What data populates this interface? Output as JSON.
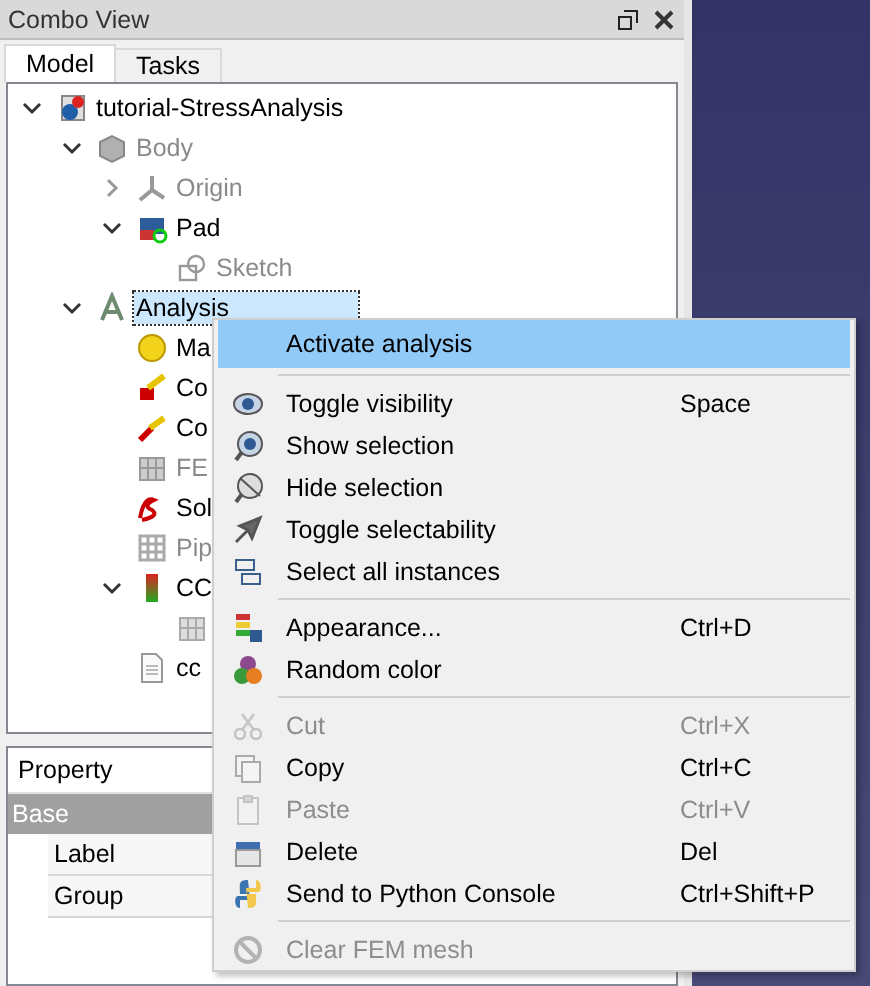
{
  "panel": {
    "title": "Combo View",
    "tabs": [
      {
        "label": "Model",
        "selected": true
      },
      {
        "label": "Tasks",
        "selected": false
      }
    ],
    "tree": [
      {
        "label": "tutorial-StressAnalysis",
        "expanded": true,
        "selected": false,
        "hidden": false,
        "children": [
          {
            "label": "Body",
            "expanded": true,
            "selected": false,
            "hidden": true,
            "children": [
              {
                "label": "Origin",
                "expanded": false,
                "selected": false,
                "hidden": true
              },
              {
                "label": "Pad",
                "expanded": true,
                "selected": false,
                "hidden": false,
                "children": [
                  {
                    "label": "Sketch",
                    "selected": false,
                    "hidden": true
                  }
                ]
              }
            ]
          },
          {
            "label": "Analysis",
            "expanded": true,
            "selected": true,
            "hidden": false,
            "children": [
              {
                "label": "Ma",
                "selected": false,
                "hidden": false
              },
              {
                "label": "Co",
                "selected": false,
                "hidden": false
              },
              {
                "label": "Co",
                "selected": false,
                "hidden": false
              },
              {
                "label": "FE",
                "selected": false,
                "hidden": true
              },
              {
                "label": "Sol",
                "selected": false,
                "hidden": false
              },
              {
                "label": "Pip",
                "selected": false,
                "hidden": true
              },
              {
                "label": "CC",
                "expanded": true,
                "selected": false,
                "hidden": false,
                "children": [
                  {
                    "selected": false
                  }
                ]
              },
              {
                "label": "cc",
                "selected": false,
                "hidden": false
              }
            ]
          }
        ]
      }
    ],
    "property_view": {
      "header": "Property",
      "group": "Base",
      "rows": [
        "Label",
        "Group"
      ]
    }
  },
  "context_menu": {
    "sections": [
      [
        {
          "label": "Activate analysis",
          "highlighted": true,
          "disabled": false
        }
      ],
      [
        {
          "label": "Toggle visibility",
          "shortcut": "Space",
          "highlighted": false,
          "disabled": false
        },
        {
          "label": "Show selection",
          "highlighted": false,
          "disabled": false
        },
        {
          "label": "Hide selection",
          "highlighted": false,
          "disabled": false
        },
        {
          "label": "Toggle selectability",
          "highlighted": false,
          "disabled": false
        },
        {
          "label": "Select all instances",
          "highlighted": false,
          "disabled": false
        }
      ],
      [
        {
          "label": "Appearance...",
          "shortcut": "Ctrl+D",
          "highlighted": false,
          "disabled": false
        },
        {
          "label": "Random color",
          "highlighted": false,
          "disabled": false
        }
      ],
      [
        {
          "label": "Cut",
          "shortcut": "Ctrl+X",
          "highlighted": false,
          "disabled": true
        },
        {
          "label": "Copy",
          "shortcut": "Ctrl+C",
          "highlighted": false,
          "disabled": false
        },
        {
          "label": "Paste",
          "shortcut": "Ctrl+V",
          "highlighted": false,
          "disabled": true
        },
        {
          "label": "Delete",
          "shortcut": "Del",
          "highlighted": false,
          "disabled": false
        },
        {
          "label": "Send to Python Console",
          "shortcut": "Ctrl+Shift+P",
          "highlighted": false,
          "disabled": false
        }
      ],
      [
        {
          "label": "Clear FEM mesh",
          "highlighted": false,
          "disabled": true
        }
      ]
    ]
  }
}
